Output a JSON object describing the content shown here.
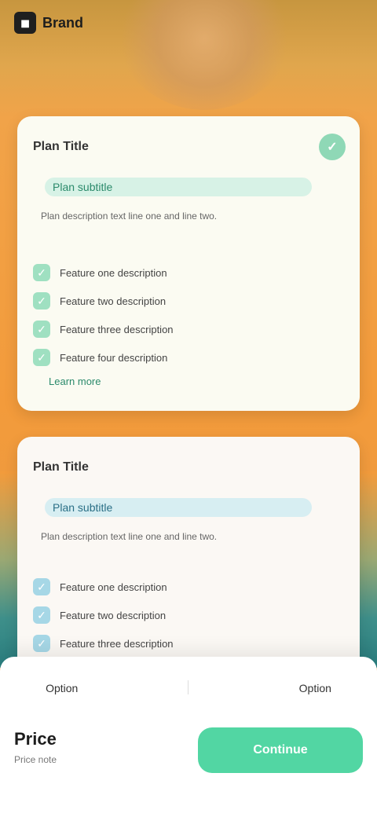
{
  "brand": {
    "name": "Brand",
    "logo_icon": "brand-icon"
  },
  "plans": [
    {
      "title": "Plan Title",
      "subtitle": "Plan subtitle",
      "description": "Plan description text line one and line two.",
      "features": [
        "Feature one description",
        "Feature two description",
        "Feature three description",
        "Feature four description"
      ],
      "link": "Learn more"
    },
    {
      "title": "Plan Title",
      "subtitle": "Plan subtitle",
      "description": "Plan description text line one and line two.",
      "features": [
        "Feature one description",
        "Feature two description",
        "Feature three description"
      ]
    }
  ],
  "bottom": {
    "tabs": [
      "Option",
      "Option"
    ],
    "price": "Price",
    "note": "Price note",
    "cta": "Continue"
  },
  "colors": {
    "accent": "#52d6a3",
    "card_bg": "#fbfbf2"
  }
}
